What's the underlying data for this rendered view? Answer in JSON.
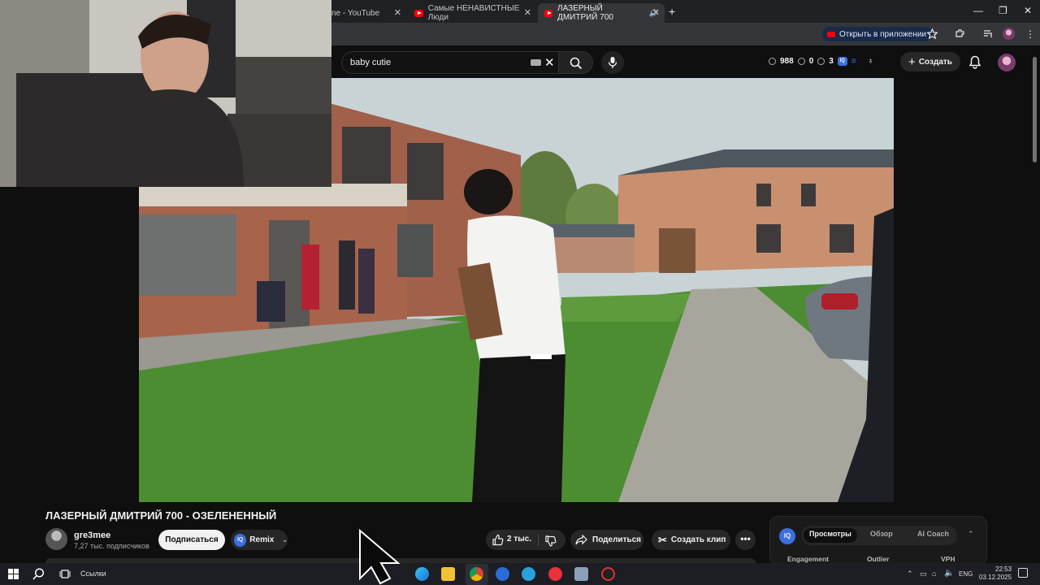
{
  "browser": {
    "tabs": [
      {
        "title": "ne - YouTube",
        "active": false
      },
      {
        "title": "Самые НЕНАВИСТНЫЕ Люди",
        "active": false
      },
      {
        "title": "ЛАЗЕРНЫЙ ДМИТРИЙ 700",
        "active": true
      }
    ],
    "new_tab": "+",
    "open_in_app": "Открыть в приложении"
  },
  "header": {
    "search_value": "baby cutie",
    "stats": {
      "views": "988",
      "eye": "0",
      "other": "3"
    },
    "create_label": "Создать"
  },
  "video": {
    "title": "ЛАЗЕРНЫЙ ДМИТРИЙ 700 - ОЗЕЛЕНЕННЫЙ",
    "channel": "gre3mee",
    "subscribers": "7,27 тыс. подписчиков",
    "subscribe_label": "Подписаться",
    "remix_label": "Remix",
    "likes": "2 тыс.",
    "share_label": "Поделиться",
    "clip_label": "Создать клип",
    "more_label": "•••"
  },
  "panel": {
    "badge": "IQ",
    "tabs": [
      "Просмотры",
      "Обзор",
      "AI Coach"
    ],
    "columns": [
      "Engagement",
      "Outlier",
      "VPH"
    ]
  },
  "taskbar": {
    "links_label": "Ссылки",
    "lang": "ENG",
    "time": "22:53",
    "date": "03.12.2025"
  },
  "colors": {
    "accent": "#ff0000",
    "iq_blue": "#3b6fe0",
    "background": "#0f0f0f"
  }
}
